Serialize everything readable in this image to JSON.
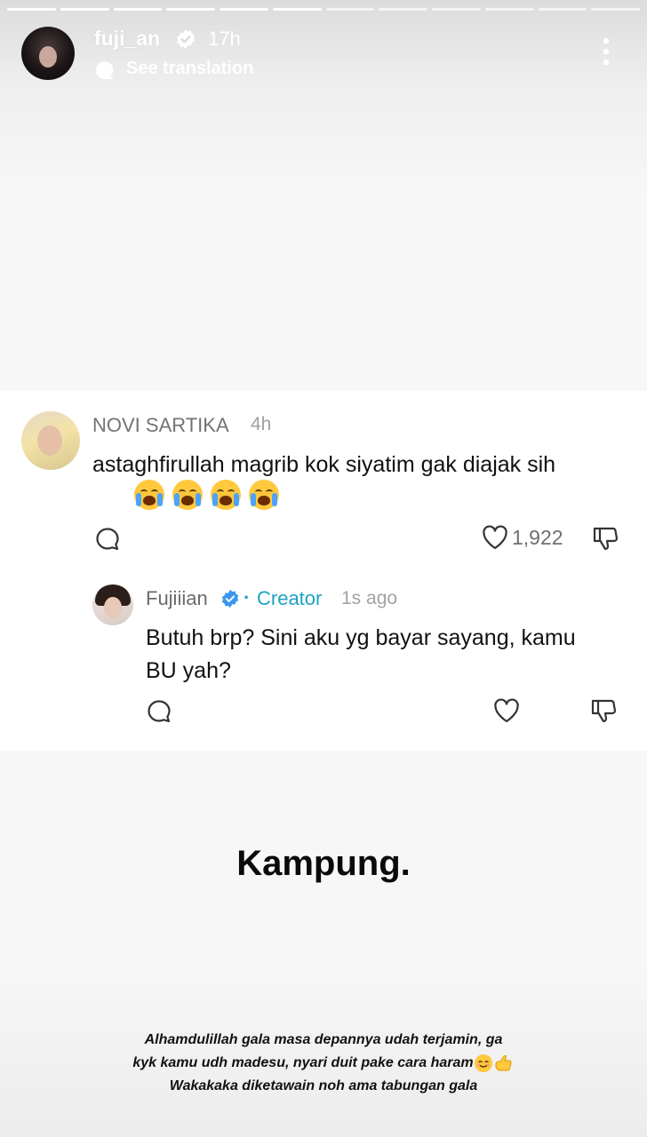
{
  "story": {
    "username": "fuji_an",
    "time": "17h",
    "translate_label": "See translation",
    "progress_segments_total": 12,
    "progress_segments_done": 6
  },
  "comment": {
    "author": "NOVI SARTIKA",
    "time": "4h",
    "text": "astaghfirullah magrib kok siyatim gak diajak sih",
    "emojis": [
      "loudly-crying-face",
      "loudly-crying-face",
      "loudly-crying-face",
      "loudly-crying-face"
    ],
    "like_count": "1,922"
  },
  "reply": {
    "author": "Fujiiian",
    "dot": "·",
    "badge": "Creator",
    "time": "1s ago",
    "text": "Butuh brp? Sini aku yg bayar sayang, kamu BU yah?"
  },
  "headline": "Kampung.",
  "caption": {
    "line1": "Alhamdulillah gala masa depannya udah terjamin, ga",
    "line2": "kyk kamu udh madesu, nyari duit pake cara haram",
    "line3": "Wakakaka diketawain noh ama tabungan gala",
    "line2_emojis": [
      "smiling-face-icon",
      "call-me-hand-icon"
    ]
  },
  "colors": {
    "creator_accent": "#1ca3c4",
    "text_primary": "#111111",
    "text_secondary": "#737373"
  }
}
